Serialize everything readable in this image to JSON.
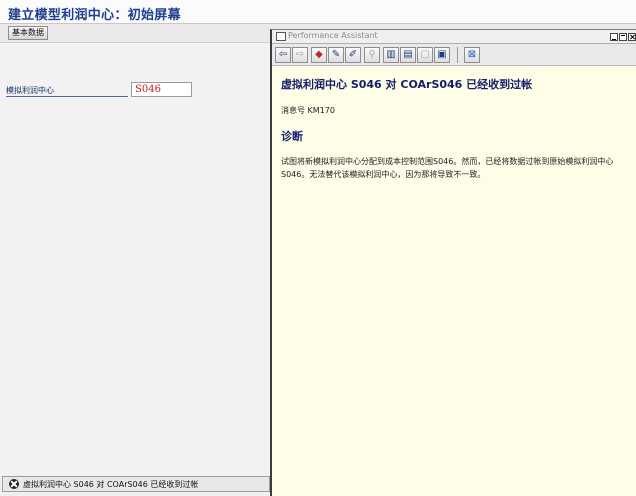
{
  "window": {
    "title": "建立模型利润中心：初始屏幕"
  },
  "toolbar": {
    "basic_data_button": "基本数据"
  },
  "form": {
    "dummy_profit_center_label": "模拟利润中心",
    "dummy_profit_center_value": "S046"
  },
  "status": {
    "message": "虚拟利润中心 S046 对 COArS046 已经收到过帐"
  },
  "assistant": {
    "title": "Performance Assistant",
    "heading": "虚拟利润中心 S046 对 COArS046 已经收到过帐",
    "message_number": "消息号 KM170",
    "diagnosis_heading": "诊断",
    "diagnosis_text": "试图将新模拟利润中心分配到成本控制范围S046。然而，已经将数据过帐到原始模拟利润中心 S046。无法替代该模拟利润中心，因为那将导致不一致。",
    "toolbar_icons": [
      "back-icon",
      "forward-icon",
      "book-icon",
      "edit-icon",
      "edit-extended-icon",
      "find-icon",
      "split-view-icon",
      "document-icon",
      "note-icon",
      "print-icon",
      "close-panel-icon"
    ]
  }
}
